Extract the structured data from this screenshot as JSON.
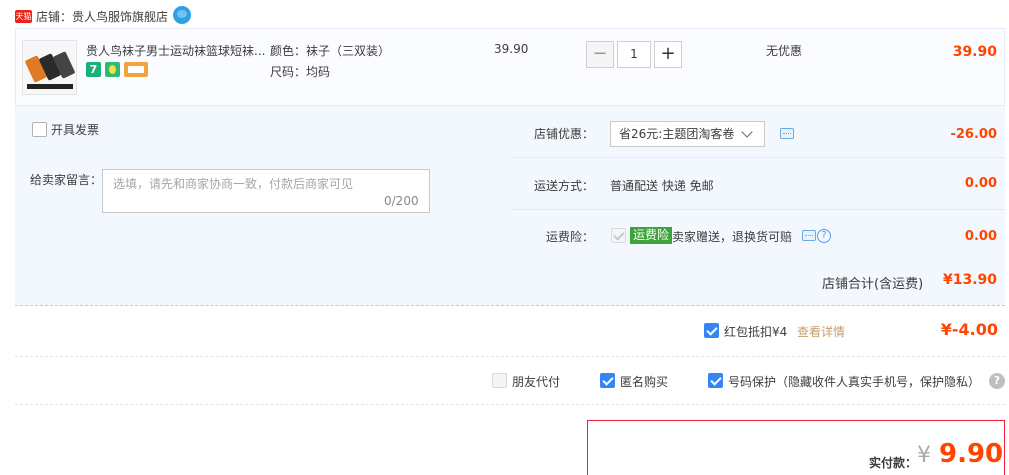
{
  "shop": {
    "platform_badge": "天猫",
    "label": "店铺：贵人鸟服饰旗舰店",
    "chat_icon": "wangwang-chat-icon"
  },
  "item": {
    "title": "贵人鸟袜子男士运动袜篮球短袜...",
    "badge_7": "7",
    "badges": [
      "seven-day-return-icon",
      "medal-icon",
      "card-icon"
    ],
    "sku_color": "颜色：袜子（三双装）",
    "sku_size": "尺码：均码",
    "unit_price": "39.90",
    "quantity": "1",
    "minus": "−",
    "plus": "+",
    "discount": "无优惠",
    "subtotal": "39.90"
  },
  "invoice": {
    "label": "开具发票"
  },
  "message": {
    "label": "给卖家留言：",
    "placeholder": "选填，请先和商家协商一致，付款后商家可见",
    "count": "0/200"
  },
  "shop_discount": {
    "label": "店铺优惠：",
    "selected": "省26元:主题团淘客卷",
    "amount": "-26.00"
  },
  "shipping": {
    "label": "运送方式：",
    "value": "普通配送 快递 免邮",
    "amount": "0.00"
  },
  "insurance": {
    "label": "运费险：",
    "badge": "运费险",
    "text": "卖家赠送，退换货可赔",
    "amount": "0.00"
  },
  "shop_total": {
    "label": "店铺合计(含运费)",
    "amount": "¥13.90"
  },
  "red_packet": {
    "label": "红包抵扣¥4",
    "link": "查看详情",
    "amount": "¥-4.00"
  },
  "services": {
    "friend_pay": "朋友代付",
    "anonymous": "匿名购买",
    "number_protect": "号码保护（隐藏收件人真实手机号，保护隐私）",
    "help": "?"
  },
  "payment": {
    "label": "实付款：",
    "yen": "¥",
    "amount": "9.90"
  },
  "colors": {
    "accent_red": "#ff4400",
    "checkbox_blue": "#3486f3",
    "panel_bg": "#f3f8fe",
    "insurance_green": "#3ea33c",
    "pay_border": "#f0203a"
  }
}
